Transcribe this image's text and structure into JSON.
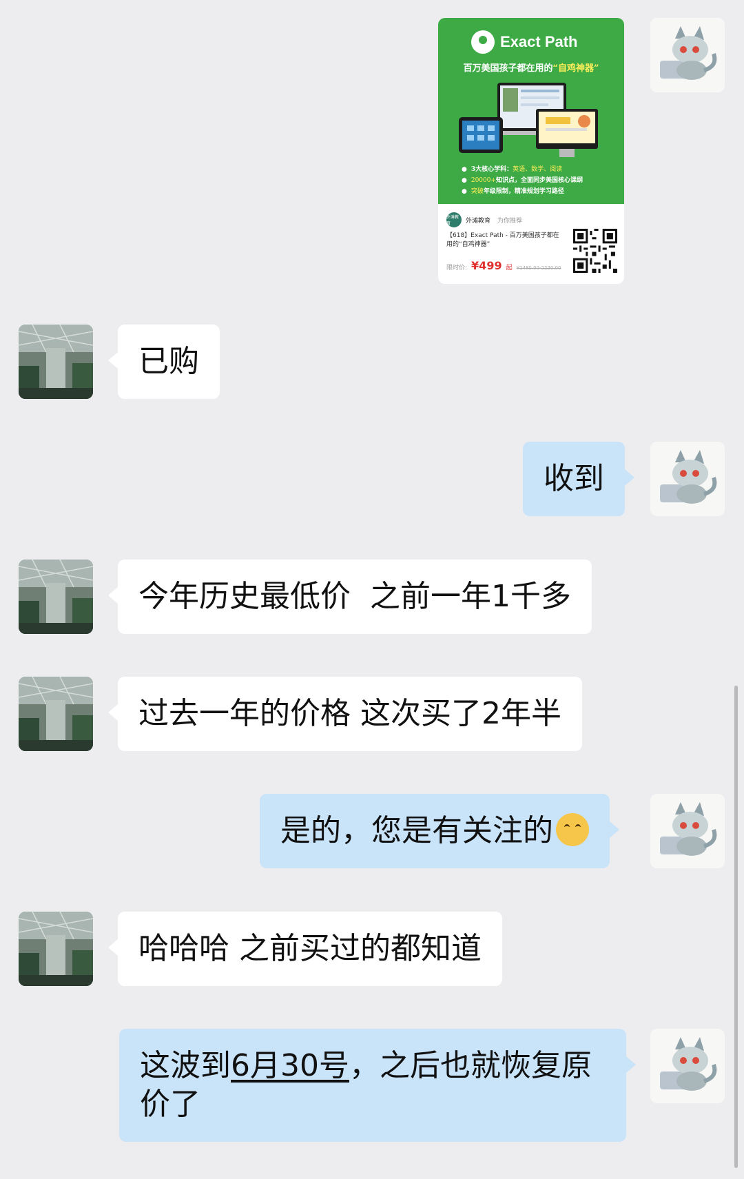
{
  "promo_card": {
    "brand": "Exact Path",
    "slogan_prefix": "百万美国孩子都在用的",
    "slogan_highlight": "“自鸡神器”",
    "features": [
      {
        "prefix": "3大核心学科：",
        "highlight": "英语、数学、阅读",
        "suffix": ""
      },
      {
        "prefix": "",
        "highlight": "20000+",
        "suffix": "知识点，全面同步美国核心课纲"
      },
      {
        "prefix": "",
        "highlight": "突破",
        "suffix": "年级限制，精准规划学习路径"
      }
    ],
    "publisher_avatar_text": "外滩教育",
    "publisher": "外滩教育",
    "recommend": "为你推荐",
    "description": "【618】Exact Path - 百万美国孩子都在用的“自鸡神器”",
    "price_label": "限时价:",
    "price": "¥499",
    "price_suffix": "起",
    "original_price": "¥1480.00-2220.00"
  },
  "messages": [
    {
      "id": "m1",
      "text": "已购"
    },
    {
      "id": "m2",
      "text": "收到"
    },
    {
      "id": "m3",
      "text": "今年历史最低价  之前一年1千多"
    },
    {
      "id": "m4",
      "text": "过去一年的价格 这次买了2年半"
    },
    {
      "id": "m5",
      "text": "是的，您是有关注的",
      "emoji": "face-with-hand-over-mouth"
    },
    {
      "id": "m6",
      "text": "哈哈哈 之前买过的都知道"
    },
    {
      "id": "m7",
      "text_before": "这波到",
      "text_link": "6月30号",
      "text_after": "，之后也就恢复原价了"
    }
  ],
  "colors": {
    "background": "#ededf0",
    "incoming_bubble": "#ffffff",
    "outgoing_bubble": "#c9e3f9",
    "card_green": "#3daa46",
    "price_red": "#e0312f"
  }
}
